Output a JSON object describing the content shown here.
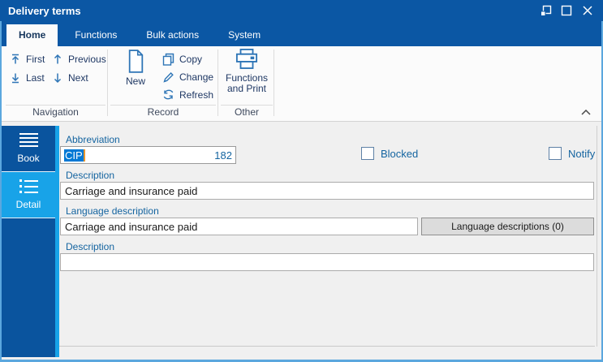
{
  "window": {
    "title": "Delivery terms",
    "controls": {
      "restore": "restore-window",
      "maximize": "maximize-window",
      "close": "close-window"
    }
  },
  "ribbon": {
    "tabs": [
      {
        "label": "Home",
        "selected": true
      },
      {
        "label": "Functions",
        "selected": false
      },
      {
        "label": "Bulk actions",
        "selected": false
      },
      {
        "label": "System",
        "selected": false
      }
    ],
    "navigation": {
      "caption": "Navigation",
      "first": "First",
      "previous": "Previous",
      "last": "Last",
      "next": "Next"
    },
    "record": {
      "caption": "Record",
      "new": "New",
      "copy": "Copy",
      "change": "Change",
      "refresh": "Refresh"
    },
    "other": {
      "caption": "Other",
      "functions_print": "Functions and Print"
    }
  },
  "sidebar": {
    "items": [
      {
        "label": "Book",
        "icon": "menu-icon",
        "selected": false
      },
      {
        "label": "Detail",
        "icon": "detail-list-icon",
        "selected": true
      }
    ]
  },
  "form": {
    "abbreviation_label": "Abbreviation",
    "abbreviation_value": "CIP",
    "abbreviation_counter": "182",
    "blocked_label": "Blocked",
    "blocked_checked": false,
    "notify_label": "Notify",
    "notify_checked": false,
    "description_label": "Description",
    "description_value": "Carriage and insurance paid",
    "language_description_label": "Language description",
    "language_description_value": "Carriage and insurance paid",
    "language_descriptions_button": "Language descriptions (0)",
    "description2_label": "Description",
    "description2_value": ""
  },
  "colors": {
    "titlebar_blue": "#0B57A4",
    "sidebar_blue": "#0A549E",
    "selected_cyan": "#18A3E8",
    "field_label_blue": "#1464A0",
    "selection_blue": "#0078D4",
    "caret_orange": "#E8962E",
    "ribbon_icon_blue": "#2E75B6"
  }
}
